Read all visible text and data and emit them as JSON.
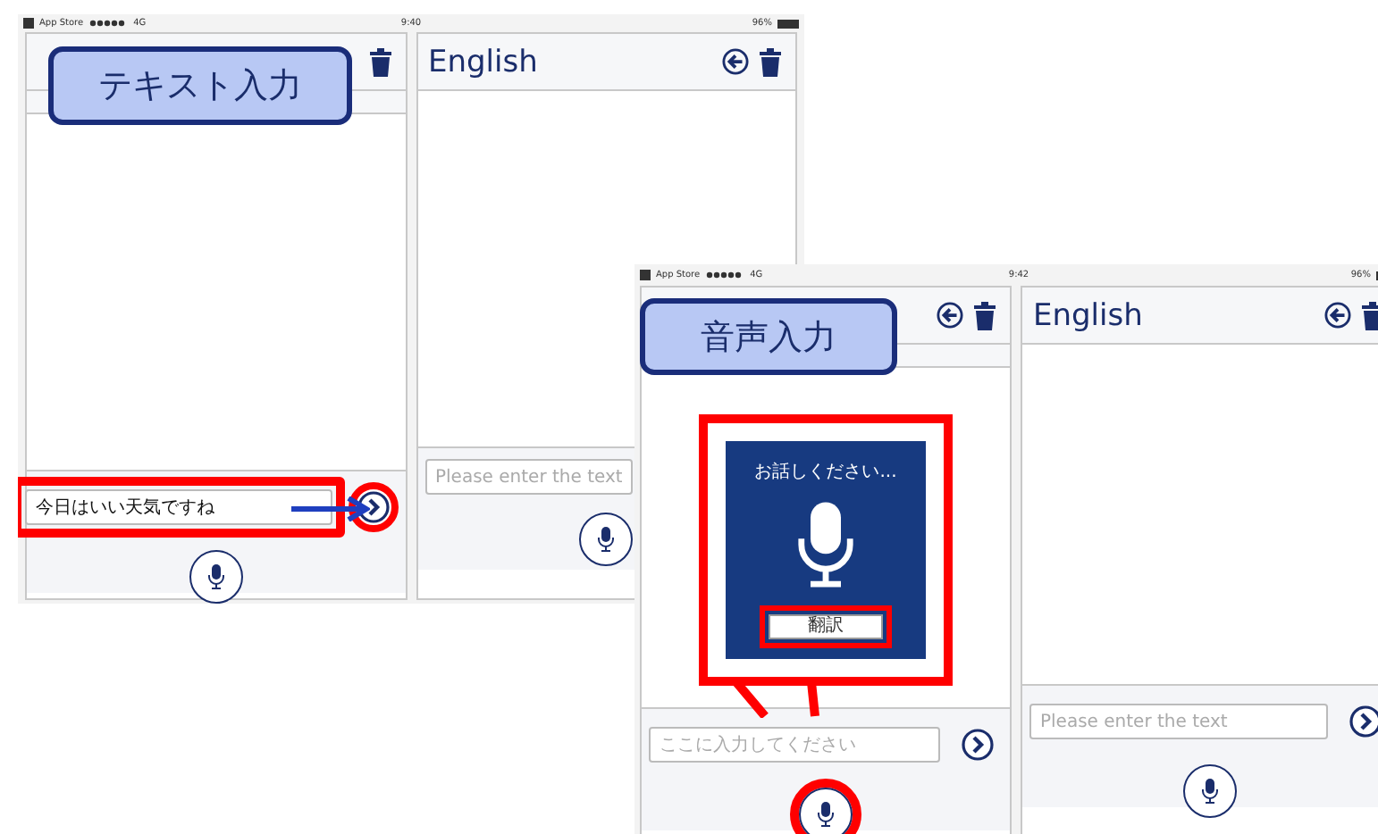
{
  "screens": [
    {
      "status_bar": {
        "carrier": "App Store",
        "network": "4G",
        "time": "9:40",
        "battery": "96%"
      },
      "callout": {
        "text": "テキスト入力"
      },
      "panes": [
        {
          "strip": true,
          "go_button": true,
          "input": {
            "value": "今日はいい天気ですね",
            "highlighted": true
          },
          "go_highlighted": true,
          "pointer_arrow": true
        },
        {
          "title": "English",
          "back_button": true,
          "input": {
            "placeholder": "Please enter the text"
          }
        }
      ]
    },
    {
      "status_bar": {
        "carrier": "App Store",
        "network": "4G",
        "time": "9:42",
        "battery": "96%"
      },
      "callout": {
        "text": "音声入力"
      },
      "panes": [
        {
          "back_button": true,
          "strip": true,
          "go_button": true,
          "dialog": {
            "prompt": "お話しください...",
            "button": "翻訳",
            "highlighted": true,
            "button_highlighted": true
          },
          "input": {
            "placeholder": "ここに入力してください"
          },
          "mic_highlighted": true
        },
        {
          "title": "English",
          "back_button": true,
          "go_button": true,
          "input": {
            "placeholder": "Please enter the text"
          }
        }
      ]
    }
  ]
}
